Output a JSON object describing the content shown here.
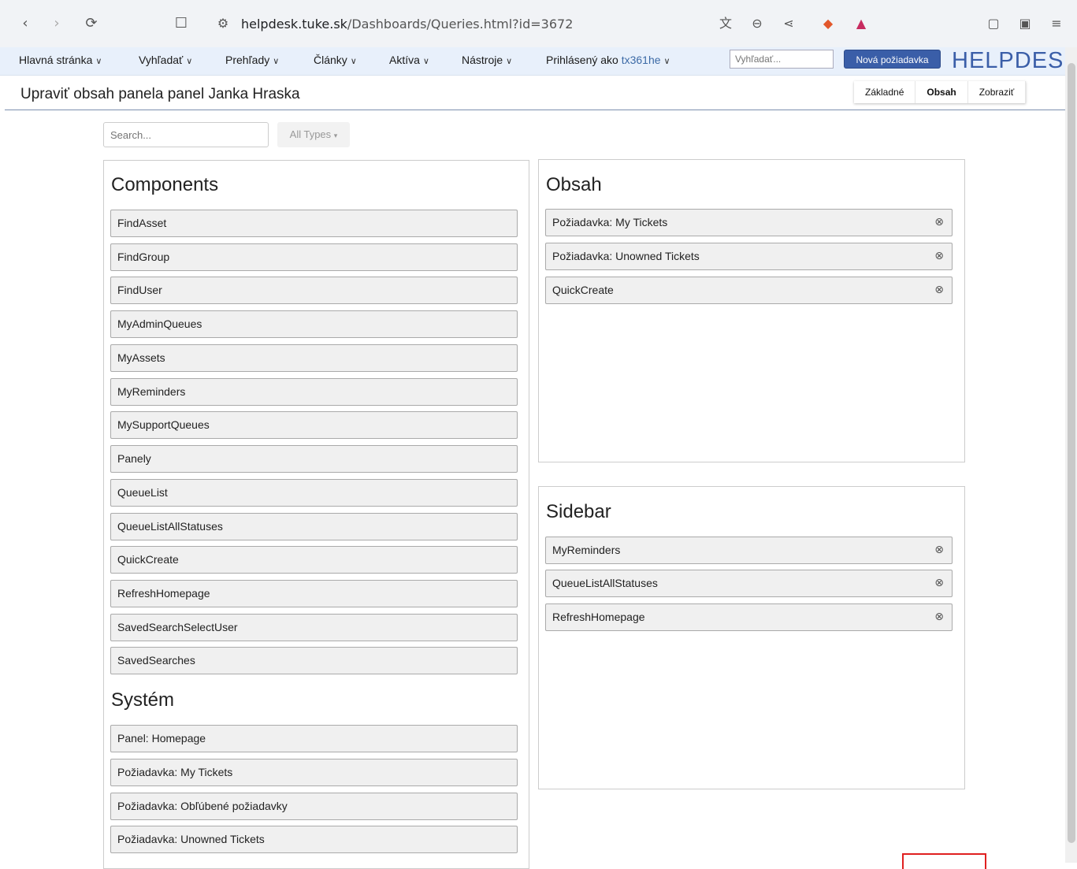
{
  "browser": {
    "back_icon": "chevron-left-icon",
    "forward_icon": "chevron-right-icon",
    "reload_icon": "reload-icon",
    "url_host": "helpdesk.tuke.sk",
    "url_path": "/Dashboards/Queries.html?id=3672"
  },
  "menu": {
    "items": [
      {
        "label": "Hlavná stránka"
      },
      {
        "label": "Vyhľadať"
      },
      {
        "label": "Prehľady"
      },
      {
        "label": "Články"
      },
      {
        "label": "Aktíva"
      },
      {
        "label": "Nástroje"
      }
    ],
    "logged_in_prefix": "Prihlásený ako",
    "username": "tx361he",
    "search_placeholder": "Vyhľadať...",
    "new_request_label": "Nová požiadavka",
    "logo": "HELPDESK"
  },
  "page": {
    "title": "Upraviť obsah panela panel Janka Hraska",
    "tabs": [
      {
        "label": "Základné",
        "active": false
      },
      {
        "label": "Obsah",
        "active": true
      },
      {
        "label": "Zobraziť",
        "active": false
      }
    ]
  },
  "filter": {
    "search_placeholder": "Search...",
    "types_label": "All Types"
  },
  "available": {
    "components_heading": "Components",
    "components": [
      "FindAsset",
      "FindGroup",
      "FindUser",
      "MyAdminQueues",
      "MyAssets",
      "MyReminders",
      "MySupportQueues",
      "Panely",
      "QueueList",
      "QueueListAllStatuses",
      "QuickCreate",
      "RefreshHomepage",
      "SavedSearchSelectUser",
      "SavedSearches"
    ],
    "system_heading": "Systém",
    "system": [
      "Panel: Homepage",
      "Požiadavka: My Tickets",
      "Požiadavka: Obľúbené požiadavky",
      "Požiadavka: Unowned Tickets"
    ]
  },
  "content": {
    "heading": "Obsah",
    "items": [
      "Požiadavka: My Tickets",
      "Požiadavka: Unowned Tickets",
      "QuickCreate"
    ]
  },
  "sidebar": {
    "heading": "Sidebar",
    "items": [
      "MyReminders",
      "QueueListAllStatuses",
      "RefreshHomepage"
    ]
  },
  "colors": {
    "accent": "#3a5ea8",
    "menu_bg": "#e8f0fb",
    "highlight_border": "#e02020"
  }
}
